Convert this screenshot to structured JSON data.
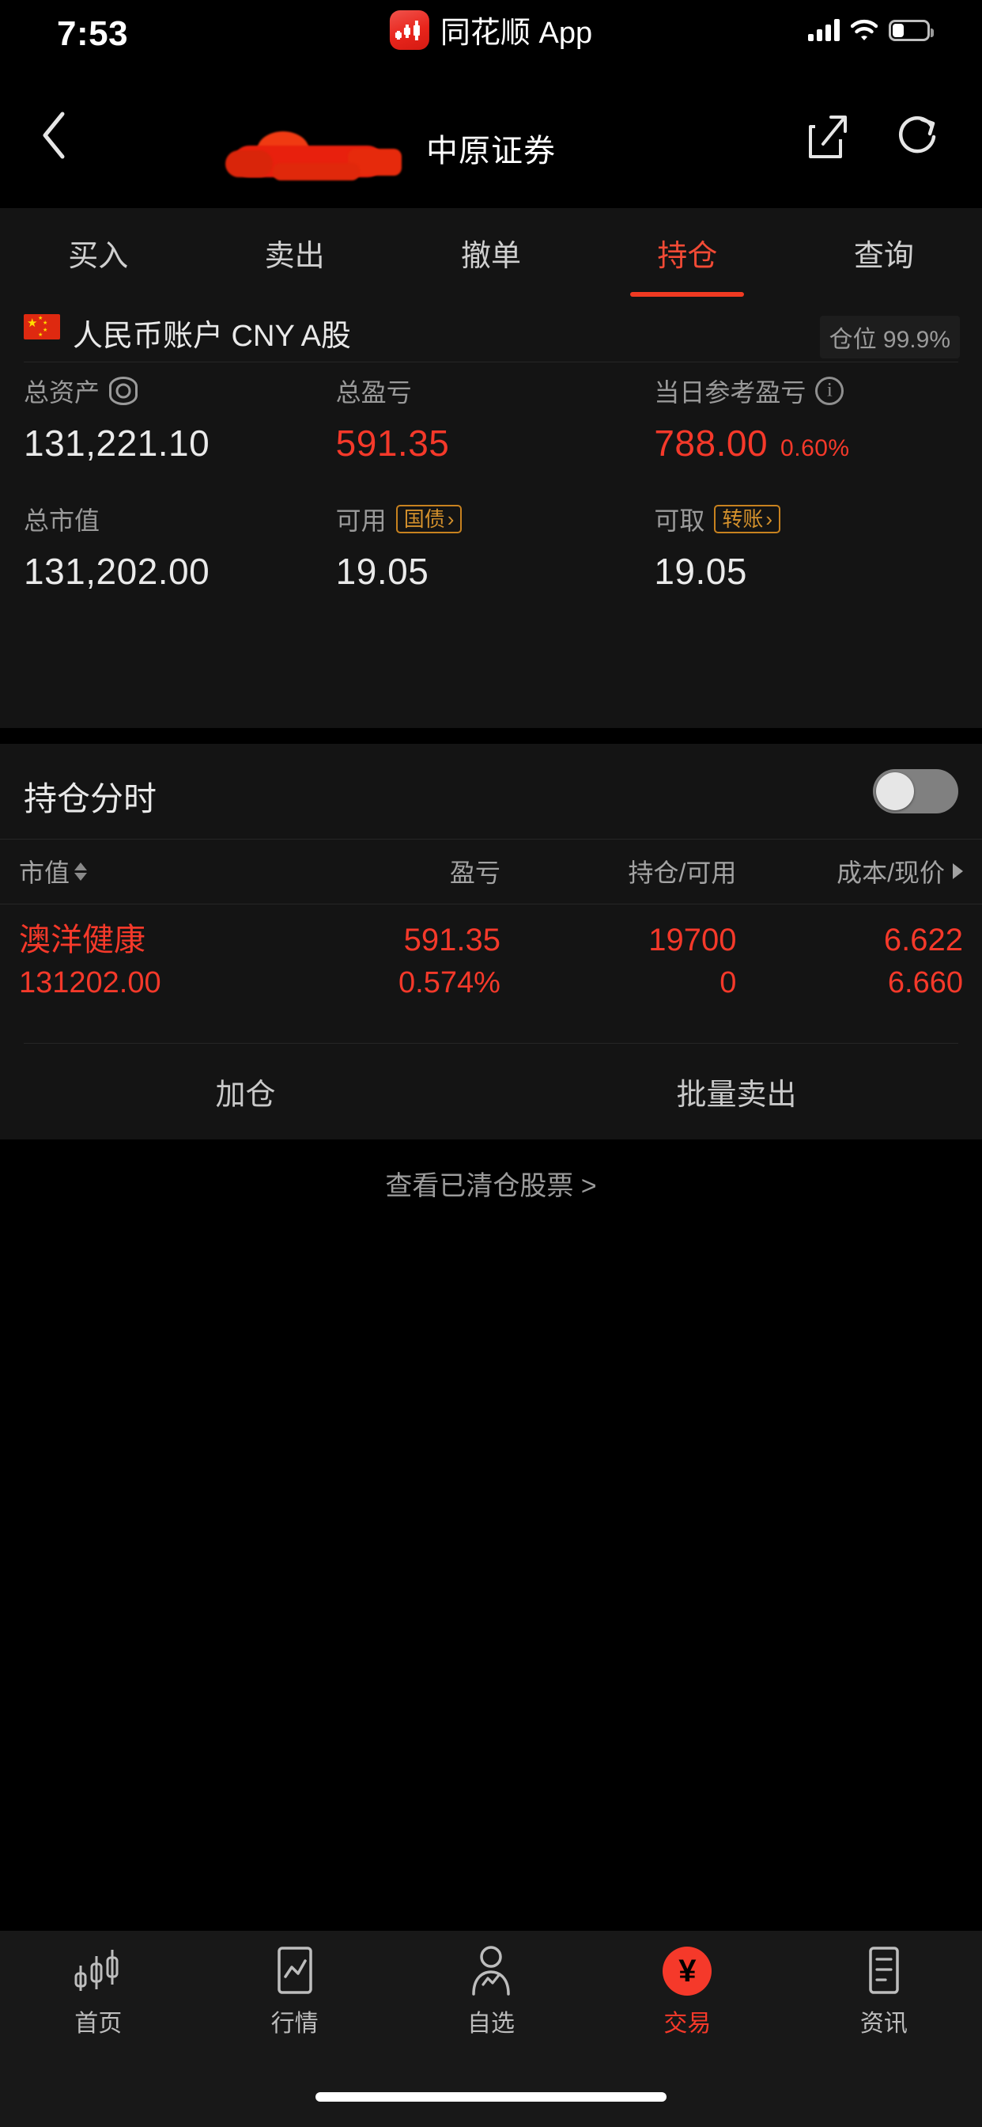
{
  "status_bar": {
    "time": "7:53",
    "app_label": "同花顺 App",
    "app_icon": "ths-app-icon",
    "signal_icon": "cellular-signal-icon",
    "wifi_icon": "wifi-icon",
    "battery_icon": "battery-icon"
  },
  "nav_bar": {
    "back_icon": "back-chevron-icon",
    "title": "中原证券",
    "title_redacted": true,
    "share_icon": "share-icon",
    "refresh_icon": "refresh-icon"
  },
  "tabs": [
    {
      "label": "买入",
      "active": false
    },
    {
      "label": "卖出",
      "active": false
    },
    {
      "label": "撤单",
      "active": false
    },
    {
      "label": "持仓",
      "active": true
    },
    {
      "label": "查询",
      "active": false
    }
  ],
  "account": {
    "flag_icon": "china-flag-icon",
    "name": "人民币账户 CNY A股",
    "position_label": "仓位 99.9%",
    "eye_icon": "eye-icon",
    "info_icon": "info-icon",
    "stats": [
      {
        "label": "总资产",
        "value": "131,221.10",
        "color": "#eaeaea",
        "icon": "eye-icon"
      },
      {
        "label": "总盈亏",
        "value": "591.35",
        "color": "#f5392a",
        "icon": ""
      },
      {
        "label": "当日参考盈亏",
        "value": "788.00",
        "pct": "0.60%",
        "color": "#f5392a",
        "icon": "info-icon"
      },
      {
        "label": "总市值",
        "value": "131,202.00",
        "color": "#eaeaea",
        "icon": ""
      },
      {
        "label": "可用",
        "value": "19.05",
        "color": "#eaeaea",
        "badge": "国债",
        "badge_arrow": "›"
      },
      {
        "label": "可取",
        "value": "19.05",
        "color": "#eaeaea",
        "badge": "转账",
        "badge_arrow": "›"
      }
    ]
  },
  "holdings": {
    "title": "持仓分时",
    "toggle_on": false,
    "toggle_icon": "toggle-switch-off",
    "columns": [
      {
        "label": "市值",
        "sort_icon": "sort-arrows-icon"
      },
      {
        "label": "盈亏",
        "sort_icon": ""
      },
      {
        "label": "持仓/可用",
        "sort_icon": ""
      },
      {
        "label": "成本/现价",
        "sort_icon": "caret-right-icon"
      }
    ],
    "rows": [
      {
        "name": "澳洋健康",
        "market_value": "131202.00",
        "profit": "591.35",
        "profit_pct": "0.574%",
        "qty": "19700",
        "available": "0",
        "cost": "6.622",
        "price": "6.660",
        "color": "#f5392a"
      }
    ],
    "actions": [
      {
        "label": "加仓"
      },
      {
        "label": "批量卖出"
      }
    ]
  },
  "cleared_link": {
    "label": "查看已清仓股票 >"
  },
  "bottom_nav": [
    {
      "label": "首页",
      "icon": "candlestick-icon",
      "active": false
    },
    {
      "label": "行情",
      "icon": "market-chart-icon",
      "active": false
    },
    {
      "label": "自选",
      "icon": "watchlist-person-icon",
      "active": false
    },
    {
      "label": "交易",
      "icon": "trade-yen-icon",
      "active": true
    },
    {
      "label": "资讯",
      "icon": "news-document-icon",
      "active": false
    }
  ],
  "colors": {
    "accent_red": "#f5392a",
    "panel_bg": "#141414",
    "page_bg": "#000000",
    "badge_orange": "#c8821f"
  }
}
